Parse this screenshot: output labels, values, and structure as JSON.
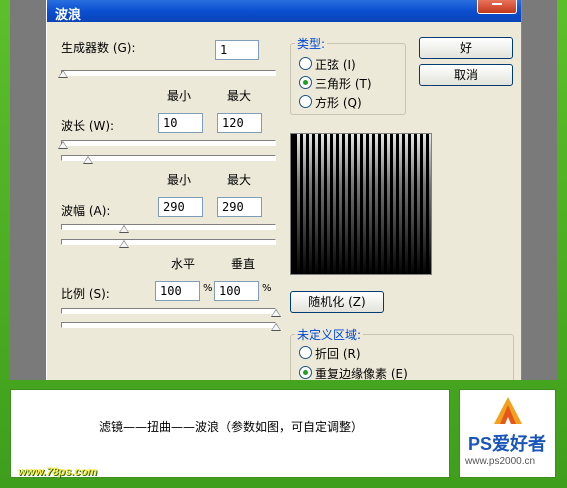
{
  "dialog": {
    "title": "波浪"
  },
  "generators": {
    "label": "生成器数 (G):",
    "value": "1"
  },
  "headers": {
    "min": "最小",
    "max": "最大",
    "horizontal": "水平",
    "vertical": "垂直"
  },
  "wavelength": {
    "label": "波长 (W):",
    "min": "10",
    "max": "120",
    "slider_min_fraction": 0.0,
    "slider_max_fraction": 0.12
  },
  "amplitude": {
    "label": "波幅 (A):",
    "min": "290",
    "max": "290",
    "slider_min_fraction": 0.3,
    "slider_max_fraction": 0.3
  },
  "scale": {
    "label": "比例 (S):",
    "horizontal": "100",
    "vertical": "100",
    "unit": "%"
  },
  "type_group": {
    "title": "类型:",
    "options": [
      {
        "label": "正弦 (I)",
        "selected": false
      },
      {
        "label": "三角形 (T)",
        "selected": true
      },
      {
        "label": "方形 (Q)",
        "selected": false
      }
    ]
  },
  "buttons": {
    "ok": "好",
    "cancel": "取消",
    "randomize": "随机化 (Z)"
  },
  "undefined_group": {
    "title": "未定义区域:",
    "options": [
      {
        "label": "折回 (R)",
        "selected": false
      },
      {
        "label": "重复边缘像素 (E)",
        "selected": true
      }
    ]
  },
  "caption": "滤镜——扭曲——波浪（参数如图，可自定调整）",
  "logo": {
    "brand": "PS爱好者",
    "url": "www.ps2000.cn"
  },
  "watermark": "www.78ps.com",
  "colors": {
    "green_frame": "#5cbf2a",
    "title_blue": "#0b4fcf",
    "group_title": "#0046d5"
  }
}
